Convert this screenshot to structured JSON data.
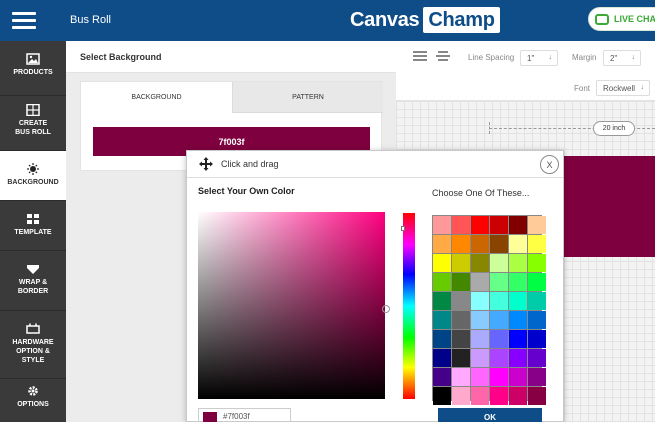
{
  "header": {
    "app_title": "Bus Roll",
    "logo": {
      "part1": "Canvas",
      "part2": "Champ"
    },
    "live_chat_label": "LIVE CHAT"
  },
  "sidebar": {
    "items": [
      {
        "label": "PRODUCTS",
        "icon": "image-icon"
      },
      {
        "label": "CREATE BUS ROLL",
        "icon": "grid-icon"
      },
      {
        "label": "BACKGROUND",
        "icon": "sun-icon",
        "active": true
      },
      {
        "label": "TEMPLATE",
        "icon": "layout-icon"
      },
      {
        "label": "WRAP & BORDER",
        "icon": "wrap-icon"
      },
      {
        "label": "HARDWARE OPTION & STYLE",
        "icon": "hardware-icon"
      },
      {
        "label": "OPTIONS",
        "icon": "gear-icon"
      }
    ]
  },
  "panel": {
    "title": "Select Background",
    "tabs": [
      {
        "label": "BACKGROUND",
        "active": true
      },
      {
        "label": "PATTERN",
        "active": false
      }
    ],
    "swatch_value": "7f003f"
  },
  "toolbar": {
    "line_spacing_label": "Line Spacing",
    "line_spacing_value": "1\"",
    "margin_label": "Margin",
    "margin_value": "2\"",
    "font_label": "Font",
    "font_value": "Rockwell"
  },
  "canvas": {
    "dimension_label": "20 inch",
    "banner_color": "#7f003f"
  },
  "color_picker": {
    "drag_label": "Click and drag",
    "close_label": "X",
    "own_color_label": "Select Your Own Color",
    "choose_label": "Choose One Of These...",
    "hex_value": "#7f003f",
    "ok_label": "OK",
    "palette": [
      "#ff9999",
      "#ff5555",
      "#ff0000",
      "#cc0000",
      "#800000",
      "#ffcc99",
      "#ffaa44",
      "#ff8800",
      "#cc6600",
      "#884400",
      "#ffff99",
      "#ffff44",
      "#ffff00",
      "#cccc00",
      "#888800",
      "#ccff99",
      "#aaff44",
      "#88ff00",
      "#66cc00",
      "#448800",
      "#aaaaaa",
      "#66ff88",
      "#33ff66",
      "#00ff44",
      "#008844",
      "#888888",
      "#88ffff",
      "#44ffdd",
      "#00ffcc",
      "#00ccaa",
      "#008888",
      "#666666",
      "#88ccff",
      "#44aaff",
      "#0088ff",
      "#0066cc",
      "#004488",
      "#444444",
      "#aaaaff",
      "#6666ff",
      "#0000ff",
      "#0000cc",
      "#000088",
      "#222222",
      "#cc99ff",
      "#aa44ff",
      "#8800ff",
      "#6600cc",
      "#440088",
      "#ffaaff",
      "#ff66ff",
      "#ff00ff",
      "#cc00cc",
      "#880088",
      "#000000",
      "#ffaacc",
      "#ff66aa",
      "#ff0088",
      "#cc0066",
      "#880044"
    ]
  }
}
